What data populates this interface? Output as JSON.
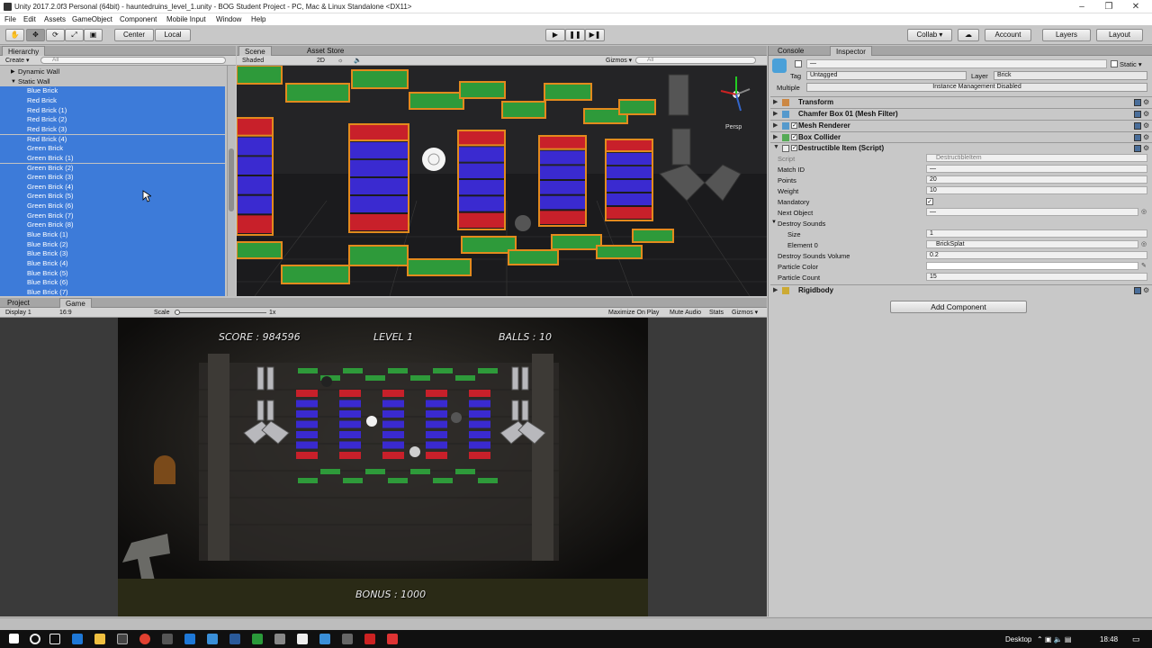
{
  "window": {
    "title": "Unity 2017.2.0f3 Personal (64bit) - hauntedruins_level_1.unity - BOG Student Project - PC, Mac & Linux Standalone <DX11>",
    "minimize": "–",
    "maximize": "❐",
    "close": "✕"
  },
  "menu": [
    "File",
    "Edit",
    "Assets",
    "GameObject",
    "Component",
    "Mobile Input",
    "Window",
    "Help"
  ],
  "toolbar": {
    "pivot": "Center",
    "space": "Local",
    "collab": "Collab ▾",
    "account": "Account",
    "layers": "Layers",
    "layout": "Layout"
  },
  "hierarchy": {
    "tab": "Hierarchy",
    "create": "Create ▾",
    "search_placeholder": "All",
    "items": [
      {
        "label": "Dynamic Wall",
        "indent": 1,
        "arrow": "▶",
        "selected": false
      },
      {
        "label": "Static Wall",
        "indent": 1,
        "arrow": "▼",
        "selected": false
      },
      {
        "label": "Blue Brick",
        "indent": 2,
        "selected": true
      },
      {
        "label": "Red Brick",
        "indent": 2,
        "selected": true
      },
      {
        "label": "Red Brick (1)",
        "indent": 2,
        "selected": true
      },
      {
        "label": "Red Brick (2)",
        "indent": 2,
        "selected": true
      },
      {
        "label": "Red Brick (3)",
        "indent": 2,
        "selected": true
      },
      {
        "label": "Red Brick (4)",
        "indent": 2,
        "selected": true
      },
      {
        "label": "Green Brick",
        "indent": 2,
        "selected": true
      },
      {
        "label": "Green Brick (1)",
        "indent": 2,
        "selected": true
      },
      {
        "label": "Green Brick (2)",
        "indent": 2,
        "selected": true
      },
      {
        "label": "Green Brick (3)",
        "indent": 2,
        "selected": true
      },
      {
        "label": "Green Brick (4)",
        "indent": 2,
        "selected": true
      },
      {
        "label": "Green Brick (5)",
        "indent": 2,
        "selected": true
      },
      {
        "label": "Green Brick (6)",
        "indent": 2,
        "selected": true
      },
      {
        "label": "Green Brick (7)",
        "indent": 2,
        "selected": true
      },
      {
        "label": "Green Brick (8)",
        "indent": 2,
        "selected": true
      },
      {
        "label": "Blue Brick (1)",
        "indent": 2,
        "selected": true
      },
      {
        "label": "Blue Brick (2)",
        "indent": 2,
        "selected": true
      },
      {
        "label": "Blue Brick (3)",
        "indent": 2,
        "selected": true
      },
      {
        "label": "Blue Brick (4)",
        "indent": 2,
        "selected": true
      },
      {
        "label": "Blue Brick (5)",
        "indent": 2,
        "selected": true
      },
      {
        "label": "Blue Brick (6)",
        "indent": 2,
        "selected": true
      },
      {
        "label": "Blue Brick (7)",
        "indent": 2,
        "selected": true
      }
    ]
  },
  "scene": {
    "tabs": [
      "Scene",
      "Asset Store"
    ],
    "shading": "Shaded",
    "mode2d": "2D",
    "gizmos": "Gizmos ▾",
    "search_placeholder": "All",
    "persp": "Persp"
  },
  "game": {
    "tabs": [
      "Project",
      "Game"
    ],
    "display": "Display 1",
    "aspect": "16:9",
    "scale_label": "Scale",
    "scale_value": "1x",
    "maximize": "Maximize On Play",
    "mute": "Mute Audio",
    "stats": "Stats",
    "gizmos": "Gizmos ▾",
    "hud": {
      "score": "SCORE : 984596",
      "level": "LEVEL 1",
      "balls": "BALLS : 10",
      "bonus": "BONUS : 1000"
    }
  },
  "inspector": {
    "tabs": [
      "Console",
      "Inspector"
    ],
    "name_value": "—",
    "static_label": "Static ▾",
    "tag_label": "Tag",
    "tag_value": "Untagged",
    "layer_label": "Layer",
    "layer_value": "Brick",
    "multiple_label": "Multiple",
    "instance_text": "Instance Management Disabled",
    "components": [
      "Transform",
      "Chamfer Box 01 (Mesh Filter)",
      "Mesh Renderer",
      "Box Collider",
      "Destructible Item (Script)"
    ],
    "fields": [
      {
        "label": "Script",
        "value": "DestructibleItem"
      },
      {
        "label": "Match ID",
        "value": "—"
      },
      {
        "label": "Points",
        "value": "20"
      },
      {
        "label": "Weight",
        "value": "10"
      },
      {
        "label": "Mandatory",
        "value": "✓"
      },
      {
        "label": "Next Object",
        "value": "—"
      },
      {
        "label": "Destroy Sounds",
        "value": ""
      },
      {
        "label": "Size",
        "value": "1"
      },
      {
        "label": "Element 0",
        "value": "BrickSplat"
      },
      {
        "label": "Destroy Sounds Volume",
        "value": "0.2"
      },
      {
        "label": "Particle Color",
        "value": ""
      },
      {
        "label": "Particle Count",
        "value": "15"
      }
    ],
    "rigidbody": "Rigidbody",
    "add_component": "Add Component"
  },
  "taskbar": {
    "desktop": "Desktop",
    "time": "18:48"
  },
  "colors": {
    "selection": "#3d7bd9",
    "editor_bg": "#c2c2c2",
    "green": "#2e9a3a",
    "red": "#c8202a",
    "blue": "#3a2ad0"
  }
}
